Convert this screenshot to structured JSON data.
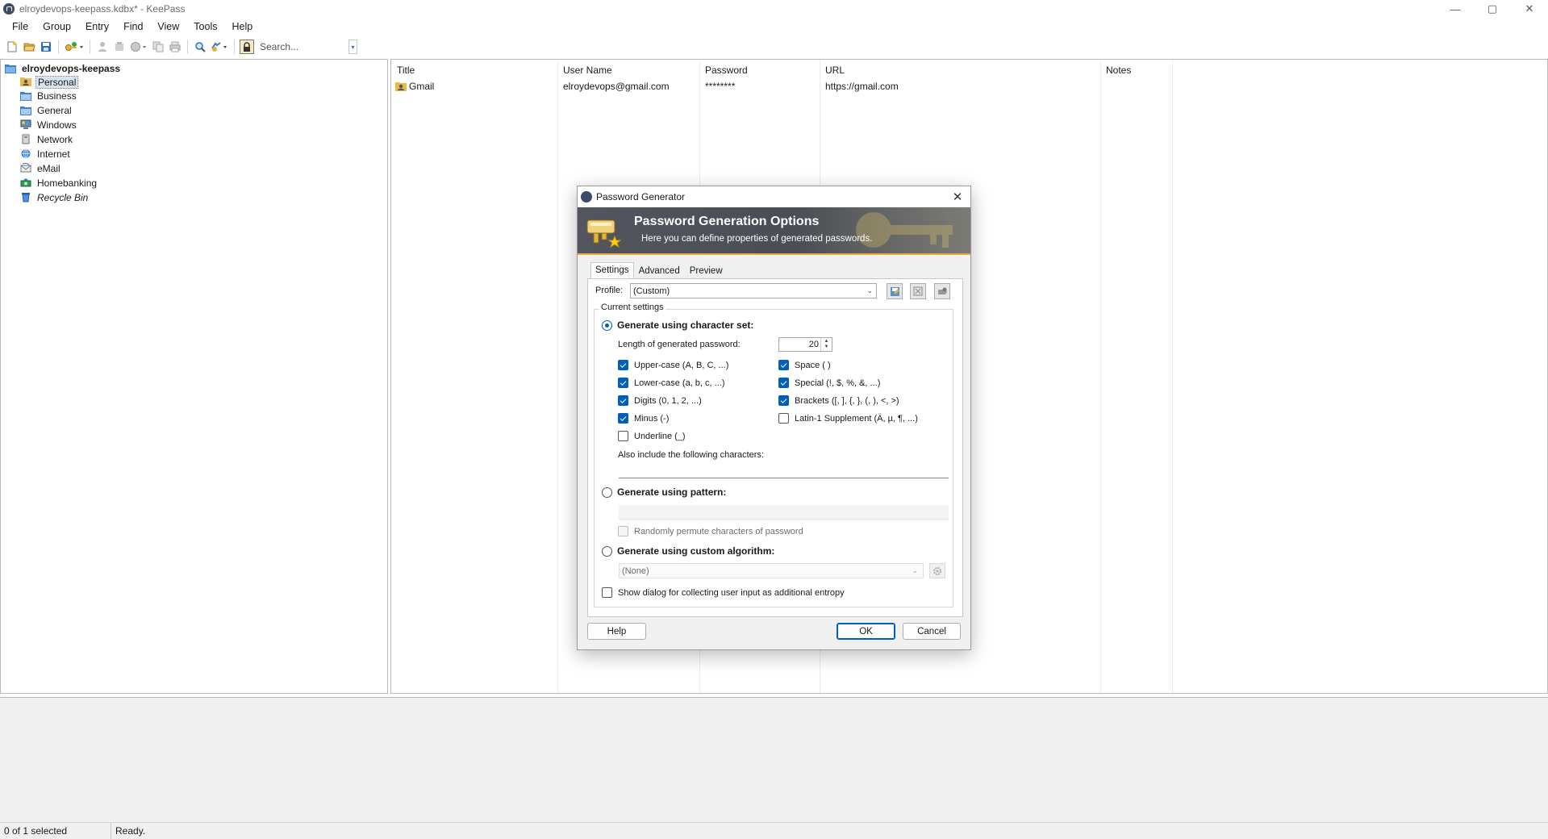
{
  "window": {
    "title": "elroydevops-keepass.kdbx* - KeePass",
    "minimize": "—",
    "maximize": "▢",
    "close": "✕"
  },
  "menu": [
    "File",
    "Group",
    "Entry",
    "Find",
    "View",
    "Tools",
    "Help"
  ],
  "toolbar": {
    "search_placeholder": "Search...",
    "dropdown_arrow": "▾"
  },
  "tree": {
    "root": "elroydevops-keepass",
    "groups": [
      "Personal",
      "Business",
      "General",
      "Windows",
      "Network",
      "Internet",
      "eMail",
      "Homebanking",
      "Recycle Bin"
    ],
    "selected": "Personal"
  },
  "entries": {
    "columns": [
      "Title",
      "User Name",
      "Password",
      "URL",
      "Notes"
    ],
    "rows": [
      {
        "title": "Gmail",
        "username": "elroydevops@gmail.com",
        "password": "********",
        "url": "https://gmail.com",
        "notes": ""
      }
    ]
  },
  "status": {
    "selection": "0 of 1 selected",
    "state": "Ready."
  },
  "dialog": {
    "title": "Password Generator",
    "close": "✕",
    "banner_title": "Password Generation Options",
    "banner_subtitle": "Here you can define properties of generated passwords.",
    "tabs": [
      "Settings",
      "Advanced",
      "Preview"
    ],
    "active_tab": "Settings",
    "profile_label": "Profile:",
    "profile_value": "(Custom)",
    "current_settings": "Current settings",
    "mode_charset": "Generate using character set:",
    "length_label": "Length of generated password:",
    "length_value": "20",
    "spin_up": "▲",
    "spin_down": "▼",
    "charsets_left": [
      {
        "label": "Upper-case (A, B, C, ...)",
        "checked": true
      },
      {
        "label": "Lower-case (a, b, c, ...)",
        "checked": true
      },
      {
        "label": "Digits (0, 1, 2, ...)",
        "checked": true
      },
      {
        "label": "Minus (-)",
        "checked": true
      },
      {
        "label": "Underline (_)",
        "checked": false
      }
    ],
    "charsets_right": [
      {
        "label": "Space ( )",
        "checked": true
      },
      {
        "label": "Special (!, $, %, &, ...)",
        "checked": true
      },
      {
        "label": "Brackets ([, ], {, }, (, ), <, >)",
        "checked": true
      },
      {
        "label": "Latin-1 Supplement (Ä, µ, ¶, ...)",
        "checked": false
      }
    ],
    "also_include_label": "Also include the following characters:",
    "also_include_value": "",
    "mode_pattern": "Generate using pattern:",
    "pattern_value": "",
    "permute_label": "Randomly permute characters of password",
    "mode_custom": "Generate using custom algorithm:",
    "algorithm_value": "(None)",
    "entropy_label": "Show dialog for collecting user input as additional entropy",
    "help_button": "Help",
    "ok_button": "OK",
    "cancel_button": "Cancel"
  },
  "colors": {
    "accent": "#005fb8",
    "banner_bg": "#4e5158",
    "banner_stripe": "#e8a73a",
    "selection": "#d9e4f2"
  }
}
